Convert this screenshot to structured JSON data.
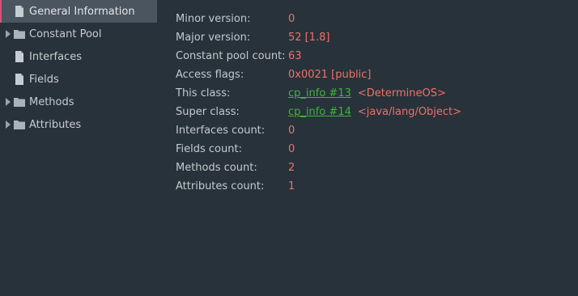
{
  "sidebar": {
    "items": [
      {
        "label": "General Information",
        "icon": "file-icon",
        "expandable": false,
        "selected": true
      },
      {
        "label": "Constant Pool",
        "icon": "folder-icon",
        "expandable": true,
        "selected": false
      },
      {
        "label": "Interfaces",
        "icon": "file-icon",
        "expandable": false,
        "selected": false
      },
      {
        "label": "Fields",
        "icon": "file-icon",
        "expandable": false,
        "selected": false
      },
      {
        "label": "Methods",
        "icon": "folder-icon",
        "expandable": true,
        "selected": false
      },
      {
        "label": "Attributes",
        "icon": "folder-icon",
        "expandable": true,
        "selected": false
      }
    ]
  },
  "details": {
    "minor_version": {
      "label": "Minor version:",
      "value": "0"
    },
    "major_version": {
      "label": "Major version:",
      "value": "52 [1.8]"
    },
    "constant_pool_count": {
      "label": "Constant pool count:",
      "value": "63"
    },
    "access_flags": {
      "label": "Access flags:",
      "value": "0x0021 [public]"
    },
    "this_class": {
      "label": "This class:",
      "link": "cp_info #13",
      "ref": "<DetermineOS>"
    },
    "super_class": {
      "label": "Super class:",
      "link": "cp_info #14",
      "ref": "<java/lang/Object>"
    },
    "interfaces_count": {
      "label": "Interfaces count:",
      "value": "0"
    },
    "fields_count": {
      "label": "Fields count:",
      "value": "0"
    },
    "methods_count": {
      "label": "Methods count:",
      "value": "2"
    },
    "attributes_count": {
      "label": "Attributes count:",
      "value": "1"
    }
  },
  "colors": {
    "background": "#28323a",
    "selection": "#4a5560",
    "selection_accent": "#d6527a",
    "label_text": "#c4c9ce",
    "value_text": "#f0706a",
    "link_text": "#3eb53e"
  }
}
